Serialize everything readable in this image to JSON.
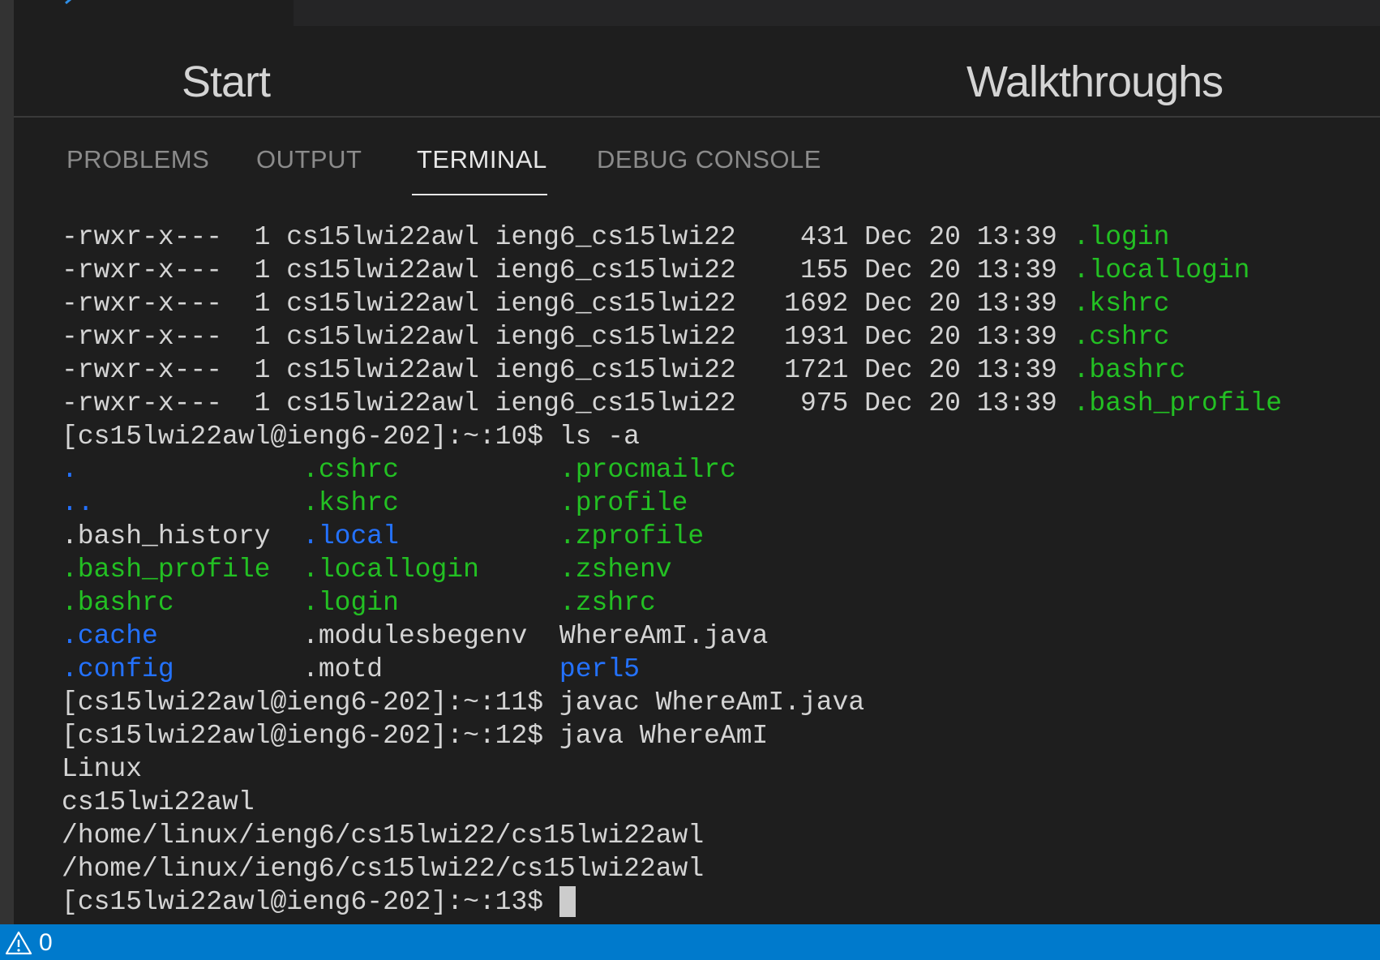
{
  "welcome": {
    "start_title": "Start",
    "walkthroughs_title": "Walkthroughs"
  },
  "panel": {
    "tabs": [
      {
        "label": "PROBLEMS"
      },
      {
        "label": "OUTPUT"
      },
      {
        "label": "TERMINAL"
      },
      {
        "label": "DEBUG CONSOLE"
      }
    ],
    "active_tab": "TERMINAL"
  },
  "terminal": {
    "ls_rows": [
      {
        "perms": "-rwxr-x---",
        "links": "1",
        "owner": "cs15lwi22awl",
        "group": "ieng6_cs15lwi22",
        "size": "431",
        "date": "Dec 20 13:39",
        "name": ".login"
      },
      {
        "perms": "-rwxr-x---",
        "links": "1",
        "owner": "cs15lwi22awl",
        "group": "ieng6_cs15lwi22",
        "size": "155",
        "date": "Dec 20 13:39",
        "name": ".locallogin"
      },
      {
        "perms": "-rwxr-x---",
        "links": "1",
        "owner": "cs15lwi22awl",
        "group": "ieng6_cs15lwi22",
        "size": "1692",
        "date": "Dec 20 13:39",
        "name": ".kshrc"
      },
      {
        "perms": "-rwxr-x---",
        "links": "1",
        "owner": "cs15lwi22awl",
        "group": "ieng6_cs15lwi22",
        "size": "1931",
        "date": "Dec 20 13:39",
        "name": ".cshrc"
      },
      {
        "perms": "-rwxr-x---",
        "links": "1",
        "owner": "cs15lwi22awl",
        "group": "ieng6_cs15lwi22",
        "size": "1721",
        "date": "Dec 20 13:39",
        "name": ".bashrc"
      },
      {
        "perms": "-rwxr-x---",
        "links": "1",
        "owner": "cs15lwi22awl",
        "group": "ieng6_cs15lwi22",
        "size": "975",
        "date": "Dec 20 13:39",
        "name": ".bash_profile"
      }
    ],
    "prompt_10": "[cs15lwi22awl@ieng6-202]:~:10$ ls -a",
    "ls_a": [
      [
        {
          "text": ".",
          "color": "blue"
        },
        {
          "text": ".cshrc",
          "color": "green"
        },
        {
          "text": ".procmailrc",
          "color": "green"
        }
      ],
      [
        {
          "text": "..",
          "color": "blue"
        },
        {
          "text": ".kshrc",
          "color": "green"
        },
        {
          "text": ".profile",
          "color": "green"
        }
      ],
      [
        {
          "text": ".bash_history",
          "color": "plain"
        },
        {
          "text": ".local",
          "color": "blue"
        },
        {
          "text": ".zprofile",
          "color": "green"
        }
      ],
      [
        {
          "text": ".bash_profile",
          "color": "green"
        },
        {
          "text": ".locallogin",
          "color": "green"
        },
        {
          "text": ".zshenv",
          "color": "green"
        }
      ],
      [
        {
          "text": ".bashrc",
          "color": "green"
        },
        {
          "text": ".login",
          "color": "green"
        },
        {
          "text": ".zshrc",
          "color": "green"
        }
      ],
      [
        {
          "text": ".cache",
          "color": "blue"
        },
        {
          "text": ".modulesbegenv",
          "color": "plain"
        },
        {
          "text": "WhereAmI.java",
          "color": "plain"
        }
      ],
      [
        {
          "text": ".config",
          "color": "blue"
        },
        {
          "text": ".motd",
          "color": "plain"
        },
        {
          "text": "perl5",
          "color": "blue"
        }
      ]
    ],
    "prompt_11": "[cs15lwi22awl@ieng6-202]:~:11$ javac WhereAmI.java",
    "prompt_12": "[cs15lwi22awl@ieng6-202]:~:12$ java WhereAmI",
    "output": [
      "Linux",
      "cs15lwi22awl",
      "/home/linux/ieng6/cs15lwi22/cs15lwi22awl",
      "/home/linux/ieng6/cs15lwi22/cs15lwi22awl"
    ],
    "prompt_13": "[cs15lwi22awl@ieng6-202]:~:13$ "
  },
  "status_bar": {
    "warnings_count": "0",
    "warning_icon": "warning-icon",
    "background_color": "#007acc"
  },
  "colors": {
    "terminal_green": "#23c023",
    "terminal_blue": "#2472ff",
    "background": "#1e1e1e"
  }
}
